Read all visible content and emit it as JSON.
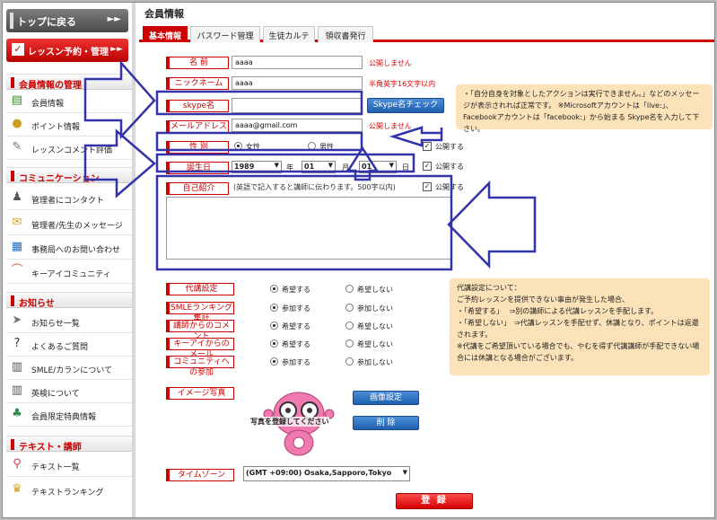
{
  "sidebar": {
    "top_button": "トップに戻る",
    "lesson_button": "レッスン予約・管理",
    "sections": [
      {
        "title": "会員情報の管理",
        "items": [
          "会員情報",
          "ポイント情報",
          "レッスンコメント評価"
        ]
      },
      {
        "title": "コミュニケーション",
        "items": [
          "管理者にコンタクト",
          "管理者/先生のメッセージ",
          "事務局へのお問い合わせ",
          "キーアイコミュニティ"
        ]
      },
      {
        "title": "お知らせ",
        "items": [
          "お知らせ一覧",
          "よくあるご質問",
          "SMLE/カランについて",
          "英検について",
          "会員限定特典情報"
        ]
      },
      {
        "title": "テキスト・講師",
        "items": [
          "テキスト一覧",
          "テキストランキング"
        ]
      }
    ]
  },
  "page": {
    "title": "会員情報"
  },
  "tabs": [
    "基本情報",
    "パスワード管理",
    "生徒カルテ",
    "領収書発行"
  ],
  "form": {
    "name": {
      "label": "名 前",
      "value": "aaaa",
      "note": "公開しません"
    },
    "nickname": {
      "label": "ニックネーム",
      "value": "aaaa",
      "note": "半角英字16文字以内"
    },
    "skype": {
      "label": "skype名",
      "value": "",
      "button": "Skype名チェック"
    },
    "email": {
      "label": "メールアドレス",
      "value": "aaaa@gmail.com",
      "note": "公開しません"
    },
    "gender": {
      "label": "性 別",
      "options": [
        "女性",
        "男性"
      ],
      "selected": "女性",
      "public_label": "公開する"
    },
    "birthday": {
      "label": "誕生日",
      "year": "1989",
      "year_unit": "年",
      "month": "01",
      "month_unit": "月",
      "day": "01",
      "day_unit": "日",
      "public_label": "公開する"
    },
    "intro": {
      "label": "自己紹介",
      "hint": "(英語で記入すると講師に伝わります。500字以内)",
      "value": "",
      "public_label": "公開する"
    },
    "substitute": {
      "label": "代講設定",
      "options": [
        "希望する",
        "希望しない"
      ],
      "selected": "希望する"
    },
    "smle_ranking": {
      "label": "SMLEランキング集計",
      "options": [
        "参加する",
        "参加しない"
      ],
      "selected": "参加する"
    },
    "teacher_comment": {
      "label": "講師からのコメント",
      "options": [
        "希望する",
        "希望しない"
      ],
      "selected": "希望する"
    },
    "keyi_mail": {
      "label": "キーアイからのメール",
      "options": [
        "希望する",
        "希望しない"
      ],
      "selected": "希望する"
    },
    "community": {
      "label": "コミュニティへの参加",
      "options": [
        "参加する",
        "参加しない"
      ],
      "selected": "参加する"
    },
    "image": {
      "label": "イメージ写真",
      "placeholder": "写真を登録してください",
      "set_button": "画像設定",
      "delete_button": "削 除"
    },
    "timezone": {
      "label": "タイムゾーン",
      "value": "(GMT +09:00) Osaka,Sapporo,Tokyo"
    },
    "submit": "登 録"
  },
  "notes": {
    "skype": [
      "・「自分自身を対象としたアクションは実行できません。」などのメッセージが表示されれば正常です。 ※Microsoftアカウントは「live:」、Facebookアカウントは「facebook:」から始まる Skype名を入力して下さい。"
    ],
    "substitute": [
      "代講設定について：",
      "ご予約レッスンを提供できない事由が発生した場合、",
      "・「希望する」　 ⇒別の講師による代講レッスンを手配します。",
      "・「希望しない」　⇒代講レッスンを手配せず、休講となり、ポイントは返還されます。",
      "※代講をご希望頂いている場合でも、やむを得ず代講講師が手配できない場合には休講となる場合がございます。"
    ]
  },
  "colors": {
    "accent": "#cc0000",
    "annotation": "#3333aa",
    "note_bg": "#fbe2b8",
    "blue_button": "#2a6bbf"
  }
}
